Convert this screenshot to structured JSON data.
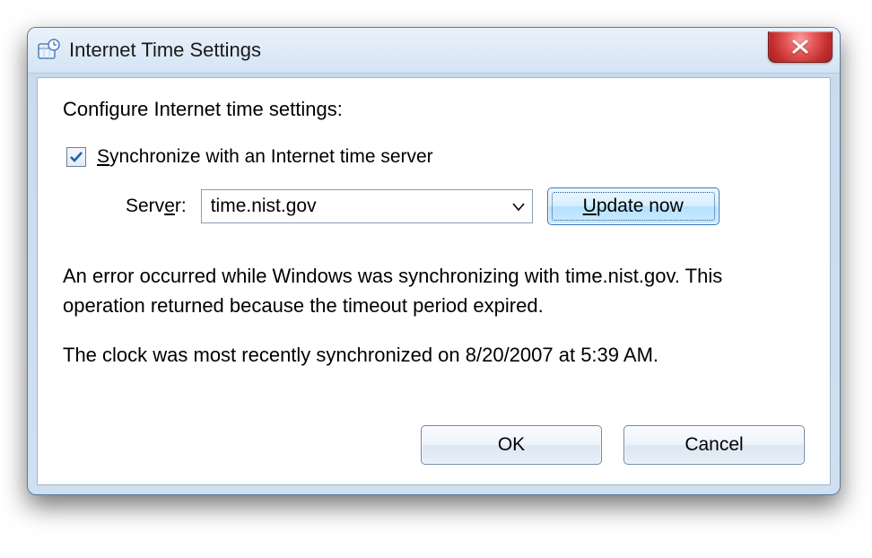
{
  "window": {
    "title": "Internet Time Settings"
  },
  "content": {
    "heading": "Configure Internet time settings:",
    "sync_checkbox": {
      "checked": true,
      "label_prefix": "S",
      "label_rest": "ynchronize with an Internet time server"
    },
    "server_label_prefix": "Serv",
    "server_label_ul": "e",
    "server_label_suffix": "r:",
    "server_value": "time.nist.gov",
    "update_btn_ul": "U",
    "update_btn_rest": "pdate now",
    "status_line1": "An error occurred while Windows was synchronizing with time.nist.gov. This operation returned because the timeout period expired.",
    "status_line2": "The clock was most recently synchronized on 8/20/2007 at 5:39 AM."
  },
  "buttons": {
    "ok": "OK",
    "cancel": "Cancel"
  }
}
